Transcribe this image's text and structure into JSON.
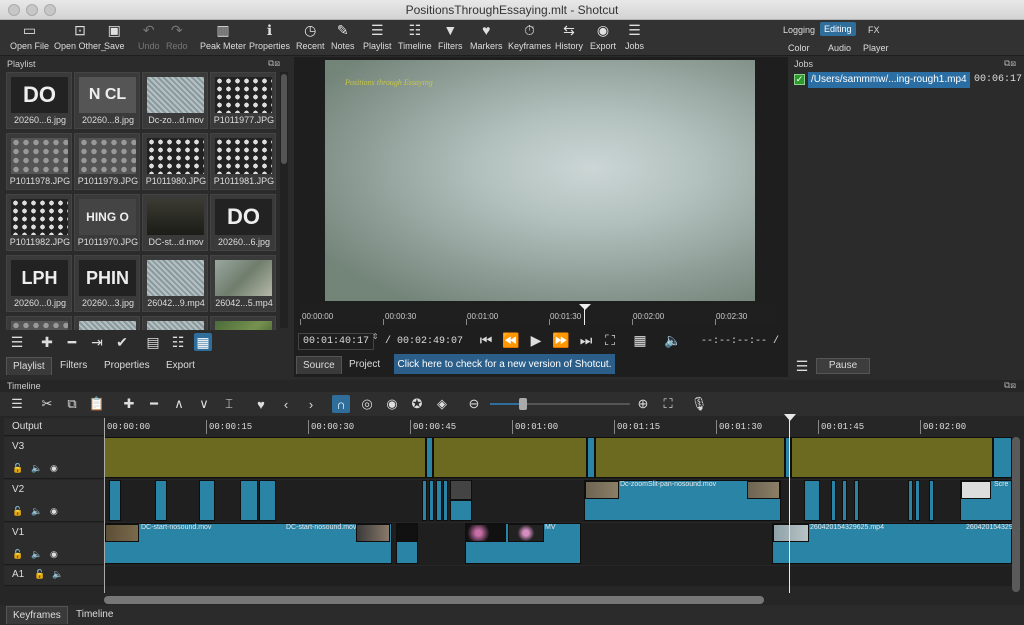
{
  "window": {
    "title": "PositionsThroughEssaying.mlt - Shotcut"
  },
  "toolbar": {
    "buttons": [
      {
        "label": "Open File",
        "icon": "folder-icon"
      },
      {
        "label": "Open Other_",
        "icon": "open-other-icon"
      },
      {
        "label": "Save",
        "icon": "save-icon"
      },
      {
        "label": "Undo",
        "icon": "undo-icon"
      },
      {
        "label": "Redo",
        "icon": "redo-icon"
      },
      {
        "label": "Peak Meter",
        "icon": "peak-meter-icon"
      },
      {
        "label": "Properties",
        "icon": "info-icon"
      },
      {
        "label": "Recent",
        "icon": "clock-icon"
      },
      {
        "label": "Notes",
        "icon": "notes-icon"
      },
      {
        "label": "Playlist",
        "icon": "list-icon"
      },
      {
        "label": "Timeline",
        "icon": "timeline-icon"
      },
      {
        "label": "Filters",
        "icon": "filter-icon"
      },
      {
        "label": "Markers",
        "icon": "marker-icon"
      },
      {
        "label": "Keyframes",
        "icon": "stopwatch-icon"
      },
      {
        "label": "History",
        "icon": "history-icon"
      },
      {
        "label": "Export",
        "icon": "export-icon"
      },
      {
        "label": "Jobs",
        "icon": "jobs-icon"
      }
    ],
    "workspaces": {
      "logging": "Logging",
      "editing": "Editing",
      "fx": "FX",
      "color": "Color",
      "audio": "Audio",
      "player": "Player"
    }
  },
  "playlist": {
    "title": "Playlist",
    "items": [
      {
        "caption": "20260...6.jpg",
        "text": "DO"
      },
      {
        "caption": "20260...8.jpg",
        "text": "N CL"
      },
      {
        "caption": "Dc-zo...d.mov",
        "text": ""
      },
      {
        "caption": "P1011977.JPG",
        "text": ""
      },
      {
        "caption": "P1011978.JPG",
        "text": ""
      },
      {
        "caption": "P1011979.JPG",
        "text": ""
      },
      {
        "caption": "P1011980.JPG",
        "text": ""
      },
      {
        "caption": "P1011981.JPG",
        "text": ""
      },
      {
        "caption": "P1011982.JPG",
        "text": ""
      },
      {
        "caption": "P1011970.JPG",
        "text": "HING O"
      },
      {
        "caption": "DC-st...d.mov",
        "text": ""
      },
      {
        "caption": "20260...6.jpg",
        "text": "DO"
      },
      {
        "caption": "20260...0.jpg",
        "text": "LPH"
      },
      {
        "caption": "20260...3.jpg",
        "text": "PHIN"
      },
      {
        "caption": "26042...9.mp4",
        "text": ""
      },
      {
        "caption": "26042...5.mp4",
        "text": ""
      }
    ],
    "tabs": [
      "Playlist",
      "Filters",
      "Properties",
      "Export"
    ]
  },
  "player": {
    "video_caption": "Positions through Essaying",
    "ruler_labels": [
      "00:00:00",
      "00:00:30",
      "00:01:00",
      "00:01:30",
      "00:02:00",
      "00:02:30"
    ],
    "current_time": "00:01:40:17",
    "duration": "/ 00:02:49:07",
    "in_out": "--:--:--:-- /",
    "tabs": [
      "Source",
      "Project"
    ],
    "update_banner": "Click here to check for a new version of Shotcut."
  },
  "jobs": {
    "title": "Jobs",
    "job_path": "/Users/sammmw/...ing-rough1.mp4",
    "job_time": "00:06:17",
    "pause_label": "Pause"
  },
  "timeline": {
    "title": "Timeline",
    "output_label": "Output",
    "ruler_labels": [
      "00:00:00",
      "00:00:15",
      "00:00:30",
      "00:00:45",
      "00:01:00",
      "00:01:15",
      "00:01:30",
      "00:01:45",
      "00:02:00"
    ],
    "tracks": [
      "V3",
      "V2",
      "V1",
      "A1"
    ],
    "clip_labels": {
      "v2_a": "Dc-zoomSlit-pan-nosound.mov",
      "v2_b": "Scre",
      "v1_a": "DC-start-nosound.mov",
      "v1_b": "DC-start-nosound.mov",
      "v1_c": "260420154329625.mp4",
      "v1_d": "26042015432962",
      "v1_e": "MV"
    }
  },
  "bottom_tabs": [
    "Keyframes",
    "Timeline"
  ],
  "colors": {
    "accent": "#2f6d9b",
    "olive_clip": "#6b6a20",
    "blue_clip": "#2a84a6"
  }
}
